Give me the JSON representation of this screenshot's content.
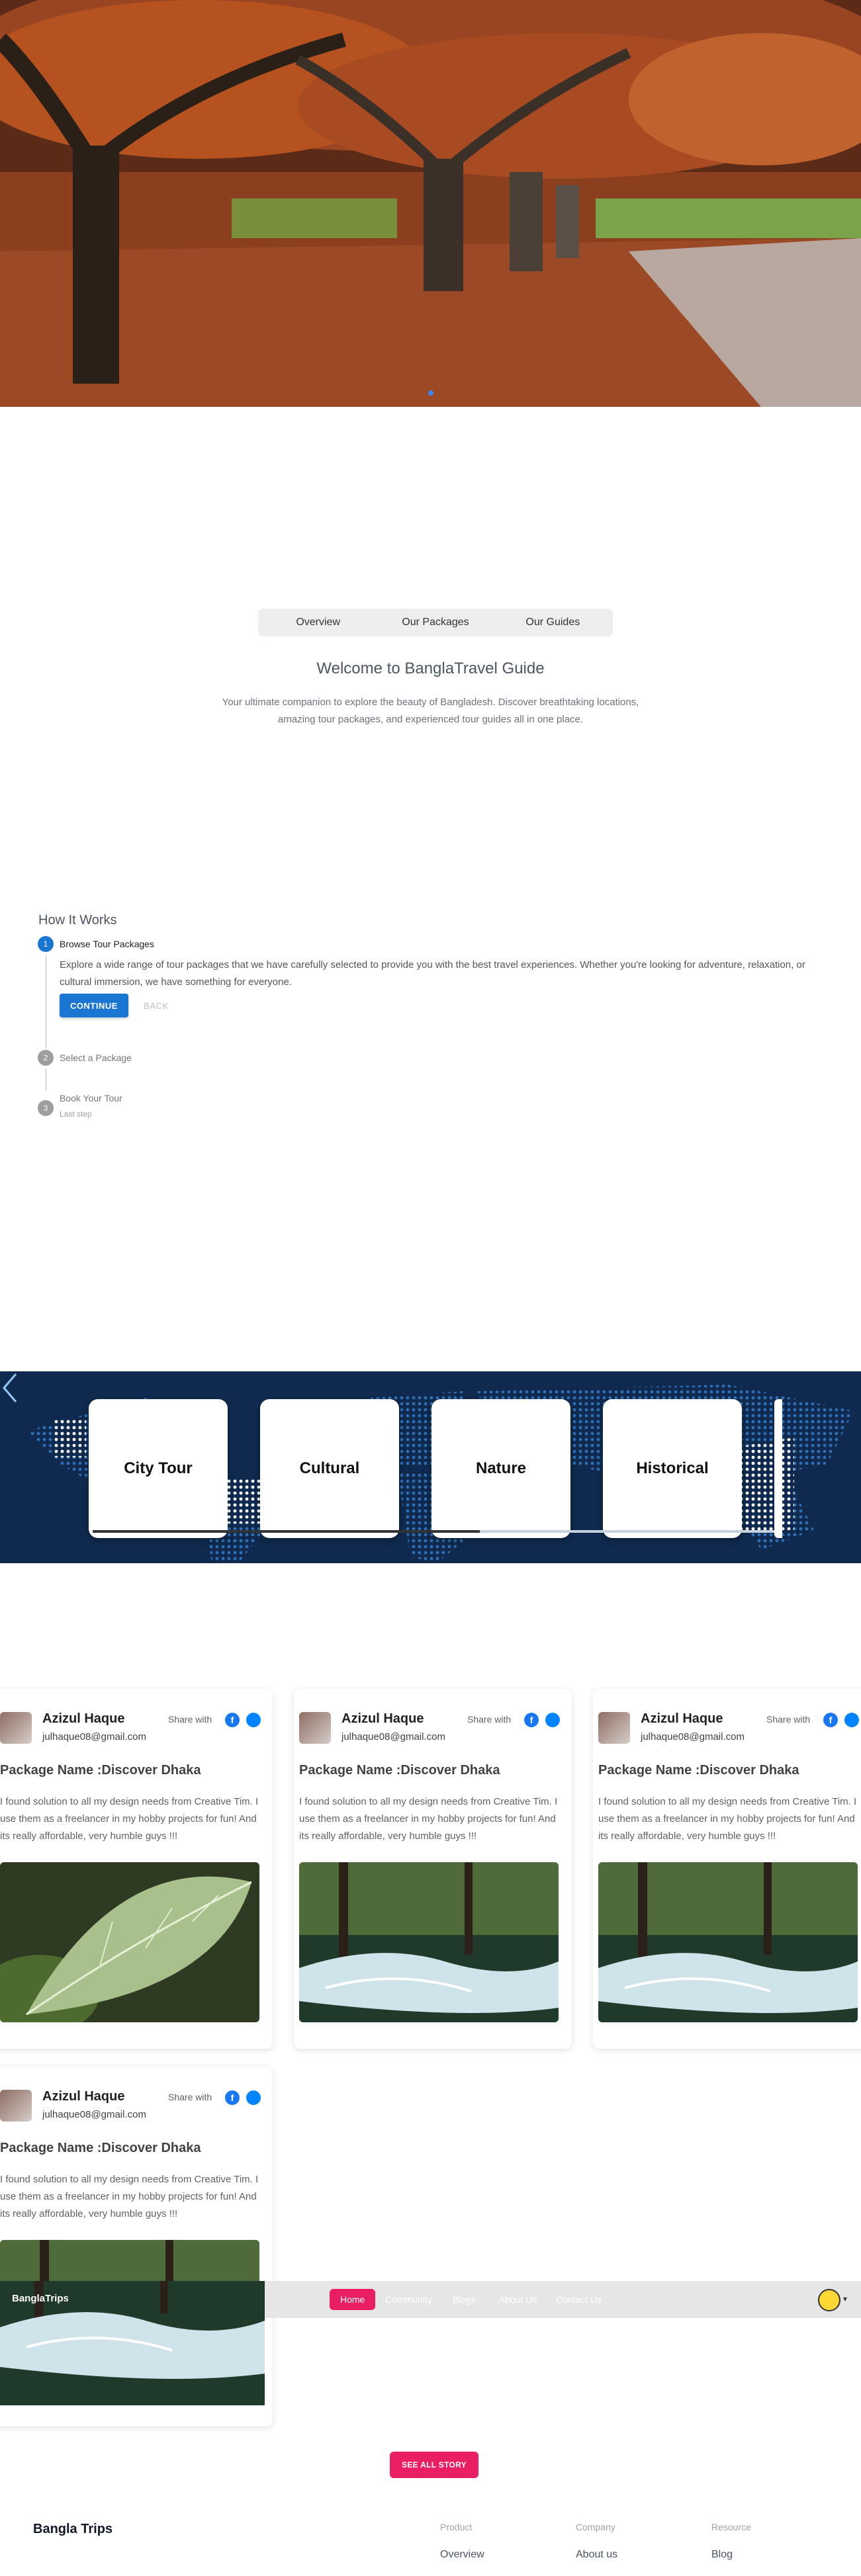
{
  "overview": {
    "tabs": [
      {
        "label": "Overview",
        "active": true
      },
      {
        "label": "Our Packages",
        "active": false
      },
      {
        "label": "Our Guides",
        "active": false
      }
    ],
    "title": "Welcome to BanglaTravel Guide",
    "description": "Your ultimate companion to explore the beauty of Bangladesh. Discover breathtaking locations, amazing tour packages, and experienced tour guides all in one place."
  },
  "how_it_works": {
    "title": "How It Works",
    "steps": [
      {
        "number": "1",
        "label": "Browse Tour Packages",
        "active": true
      },
      {
        "number": "2",
        "label": "Select a Package",
        "active": false
      },
      {
        "number": "3",
        "label": "Book Your Tour",
        "sub": "Last step",
        "active": false
      }
    ],
    "active_description": "Explore a wide range of tour packages that we have carefully selected to provide you with the best travel experiences. Whether you're looking for adventure, relaxation, or cultural immersion, we have something for everyone.",
    "continue_label": "CONTINUE",
    "back_label": "BACK"
  },
  "categories": [
    "City Tour",
    "Cultural",
    "Nature",
    "Historical"
  ],
  "stories": [
    {
      "name": "Azizul Haque",
      "email": "julhaque08@gmail.com",
      "share_label": "Share with",
      "package": "Package Name :Discover Dhaka",
      "description": "I found solution to all my design needs from Creative Tim. I use them as a freelancer in my hobby projects for fun! And its really affordable, very humble guys !!!",
      "photo": "leaf"
    },
    {
      "name": "Azizul Haque",
      "email": "julhaque08@gmail.com",
      "share_label": "Share with",
      "package": "Package Name :Discover Dhaka",
      "description": "I found solution to all my design needs from Creative Tim. I use them as a freelancer in my hobby projects for fun! And its really affordable, very humble guys !!!",
      "photo": "forest-stream"
    },
    {
      "name": "Azizul Haque",
      "email": "julhaque08@gmail.com",
      "share_label": "Share with",
      "package": "Package Name :Discover Dhaka",
      "description": "I found solution to all my design needs from Creative Tim. I use them as a freelancer in my hobby projects for fun! And its really affordable, very humble guys !!!",
      "photo": "forest-stream"
    },
    {
      "name": "Azizul Haque",
      "email": "julhaque08@gmail.com",
      "share_label": "Share with",
      "package": "Package Name :Discover Dhaka",
      "description": "I found solution to all my design needs from Creative Tim. I use them as a freelancer in my hobby projects for fun! And its really affordable, very humble guys !!!",
      "photo": "forest-stream"
    }
  ],
  "navbar": {
    "brand": "BanglaTrips",
    "items": [
      {
        "label": "Home",
        "active": true
      },
      {
        "label": "Community",
        "active": false
      },
      {
        "label": "Blogs",
        "active": false
      },
      {
        "label": "About Us",
        "active": false
      },
      {
        "label": "Contact Us",
        "active": false
      }
    ]
  },
  "see_all_label": "SEE ALL STORY",
  "footer": {
    "brand": "Bangla Trips",
    "columns": [
      {
        "heading": "Product",
        "links": [
          "Overview"
        ]
      },
      {
        "heading": "Company",
        "links": [
          "About us"
        ]
      },
      {
        "heading": "Resource",
        "links": [
          "Blog"
        ]
      }
    ]
  },
  "colors": {
    "primary": "#1976d2",
    "accent": "#e91e63",
    "band": "#0f2a4e"
  }
}
